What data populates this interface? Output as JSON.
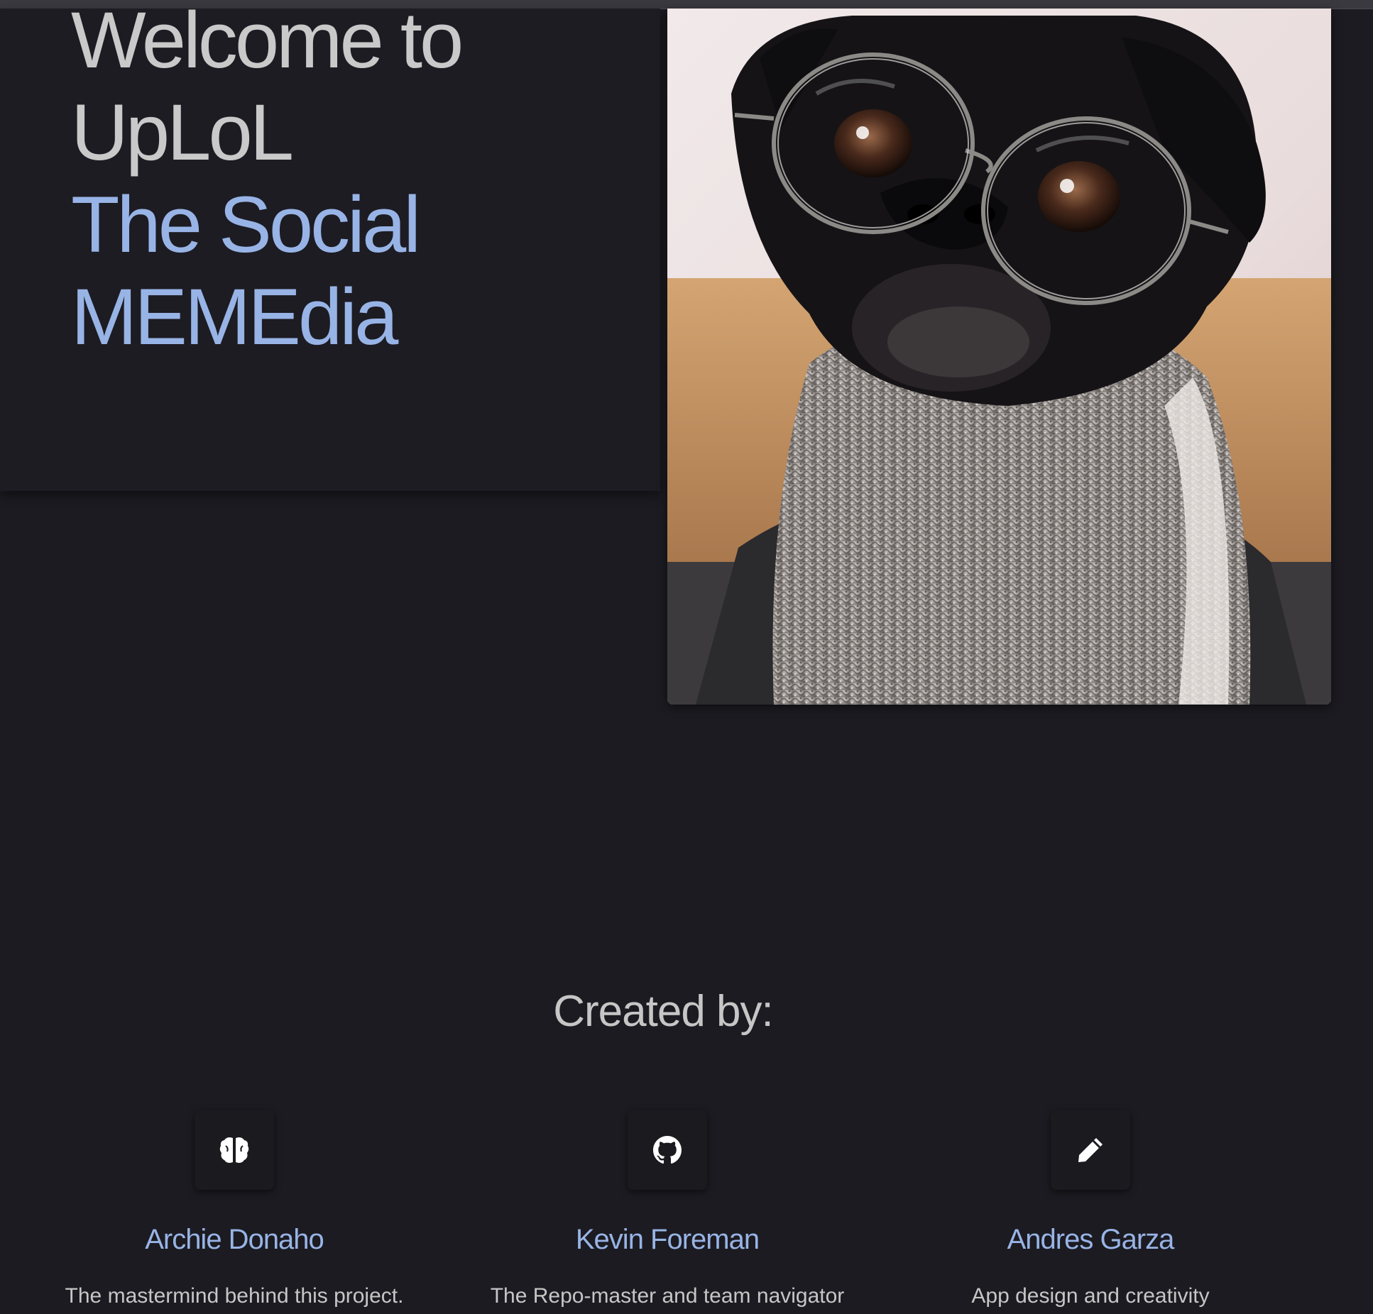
{
  "hero": {
    "line1": "Welcome to",
    "line2": "UpLoL",
    "line3": "The Social",
    "line4": "MEMEdia",
    "image_subject": "pug wearing round glasses and a knitted sweater"
  },
  "team": {
    "heading": "Created by:",
    "members": [
      {
        "icon": "brain-icon",
        "name": "Archie Donaho",
        "role": "The mastermind behind this project."
      },
      {
        "icon": "github-icon",
        "name": "Kevin Foreman",
        "role": "The Repo-master and team navigator"
      },
      {
        "icon": "pencil-icon",
        "name": "Andres Garza",
        "role": "App design and creativity"
      }
    ]
  },
  "colors": {
    "background": "#1c1b21",
    "accent": "#98b4e6",
    "text": "#c6c6c6"
  }
}
